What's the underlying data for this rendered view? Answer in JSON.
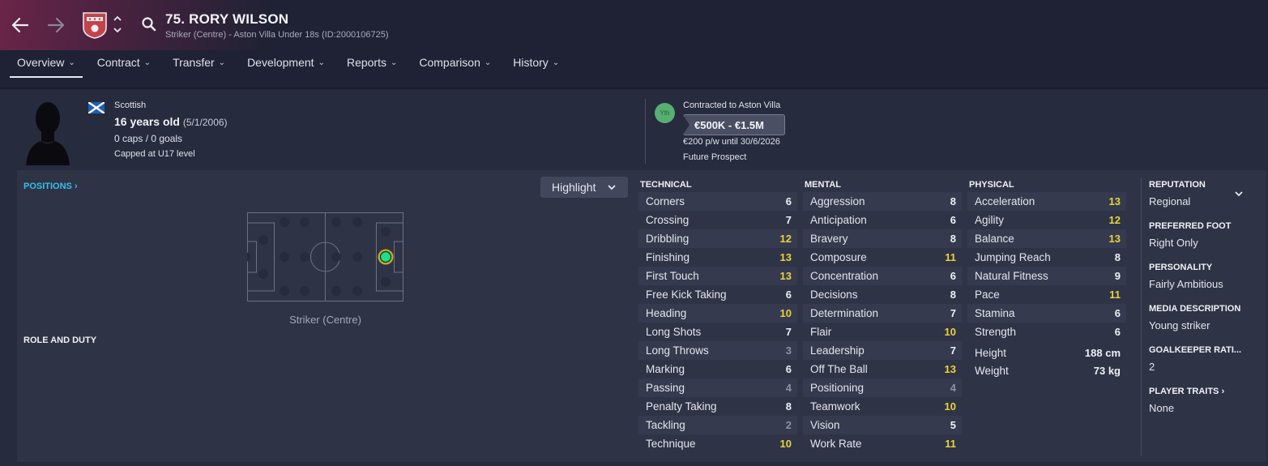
{
  "header": {
    "player_name": "75. RORY WILSON",
    "subtitle": "Striker (Centre) - Aston Villa Under 18s (ID:2000106725)",
    "icons": [
      "back-arrow-icon",
      "forward-arrow-icon",
      "club-crest-icon",
      "up-down-chevron-icon",
      "search-icon"
    ]
  },
  "tabs": [
    {
      "label": "Overview",
      "active": true
    },
    {
      "label": "Contract"
    },
    {
      "label": "Transfer"
    },
    {
      "label": "Development"
    },
    {
      "label": "Reports"
    },
    {
      "label": "Comparison"
    },
    {
      "label": "History"
    }
  ],
  "profile": {
    "nationality": "Scottish",
    "age": "16 years old",
    "dob": "(5/1/2006)",
    "caps": "0 caps / 0 goals",
    "capped_level": "Capped at U17 level"
  },
  "contract": {
    "badge": "Yth",
    "contracted": "Contracted to Aston Villa",
    "value": "€500K - €1.5M",
    "wage": "€200 p/w until 30/6/2026",
    "status": "Future Prospect"
  },
  "positions": {
    "link_label": "POSITIONS",
    "highlight_label": "Highlight",
    "position_label": "Striker (Centre)",
    "role_duty_label": "ROLE AND DUTY"
  },
  "technical": {
    "title": "TECHNICAL",
    "items": [
      {
        "name": "Corners",
        "value": "6",
        "tier": "w"
      },
      {
        "name": "Crossing",
        "value": "7",
        "tier": "w"
      },
      {
        "name": "Dribbling",
        "value": "12",
        "tier": "y"
      },
      {
        "name": "Finishing",
        "value": "13",
        "tier": "y"
      },
      {
        "name": "First Touch",
        "value": "13",
        "tier": "y"
      },
      {
        "name": "Free Kick Taking",
        "value": "6",
        "tier": "w"
      },
      {
        "name": "Heading",
        "value": "10",
        "tier": "y"
      },
      {
        "name": "Long Shots",
        "value": "7",
        "tier": "w"
      },
      {
        "name": "Long Throws",
        "value": "3",
        "tier": "g"
      },
      {
        "name": "Marking",
        "value": "6",
        "tier": "w"
      },
      {
        "name": "Passing",
        "value": "4",
        "tier": "g"
      },
      {
        "name": "Penalty Taking",
        "value": "8",
        "tier": "w"
      },
      {
        "name": "Tackling",
        "value": "2",
        "tier": "g"
      },
      {
        "name": "Technique",
        "value": "10",
        "tier": "y"
      }
    ]
  },
  "mental": {
    "title": "MENTAL",
    "items": [
      {
        "name": "Aggression",
        "value": "8",
        "tier": "w"
      },
      {
        "name": "Anticipation",
        "value": "6",
        "tier": "w"
      },
      {
        "name": "Bravery",
        "value": "8",
        "tier": "w"
      },
      {
        "name": "Composure",
        "value": "11",
        "tier": "y"
      },
      {
        "name": "Concentration",
        "value": "6",
        "tier": "w"
      },
      {
        "name": "Decisions",
        "value": "8",
        "tier": "w"
      },
      {
        "name": "Determination",
        "value": "7",
        "tier": "w"
      },
      {
        "name": "Flair",
        "value": "10",
        "tier": "y"
      },
      {
        "name": "Leadership",
        "value": "7",
        "tier": "w"
      },
      {
        "name": "Off The Ball",
        "value": "13",
        "tier": "y"
      },
      {
        "name": "Positioning",
        "value": "4",
        "tier": "g"
      },
      {
        "name": "Teamwork",
        "value": "10",
        "tier": "y"
      },
      {
        "name": "Vision",
        "value": "5",
        "tier": "w"
      },
      {
        "name": "Work Rate",
        "value": "11",
        "tier": "y"
      }
    ]
  },
  "physical": {
    "title": "PHYSICAL",
    "items": [
      {
        "name": "Acceleration",
        "value": "13",
        "tier": "y"
      },
      {
        "name": "Agility",
        "value": "12",
        "tier": "y"
      },
      {
        "name": "Balance",
        "value": "13",
        "tier": "y"
      },
      {
        "name": "Jumping Reach",
        "value": "8",
        "tier": "w"
      },
      {
        "name": "Natural Fitness",
        "value": "9",
        "tier": "w"
      },
      {
        "name": "Pace",
        "value": "11",
        "tier": "y"
      },
      {
        "name": "Stamina",
        "value": "6",
        "tier": "w"
      },
      {
        "name": "Strength",
        "value": "6",
        "tier": "w"
      }
    ],
    "height_label": "Height",
    "height_value": "188 cm",
    "weight_label": "Weight",
    "weight_value": "73 kg"
  },
  "info": [
    {
      "title": "REPUTATION",
      "value": "Regional"
    },
    {
      "title": "PREFERRED FOOT",
      "value": "Right Only"
    },
    {
      "title": "PERSONALITY",
      "value": "Fairly Ambitious"
    },
    {
      "title": "MEDIA DESCRIPTION",
      "value": "Young striker"
    },
    {
      "title": "GOALKEEPER RATI...",
      "value": "2"
    },
    {
      "title": "PLAYER TRAITS",
      "value": "None"
    }
  ],
  "colors": {
    "background": "#272b3e",
    "panel": "#2f3346",
    "accent_link": "#35c0ea",
    "attr_high": "#e6d53c",
    "attr_low": "#8e91a0",
    "position_dot": "#1ee08a"
  }
}
